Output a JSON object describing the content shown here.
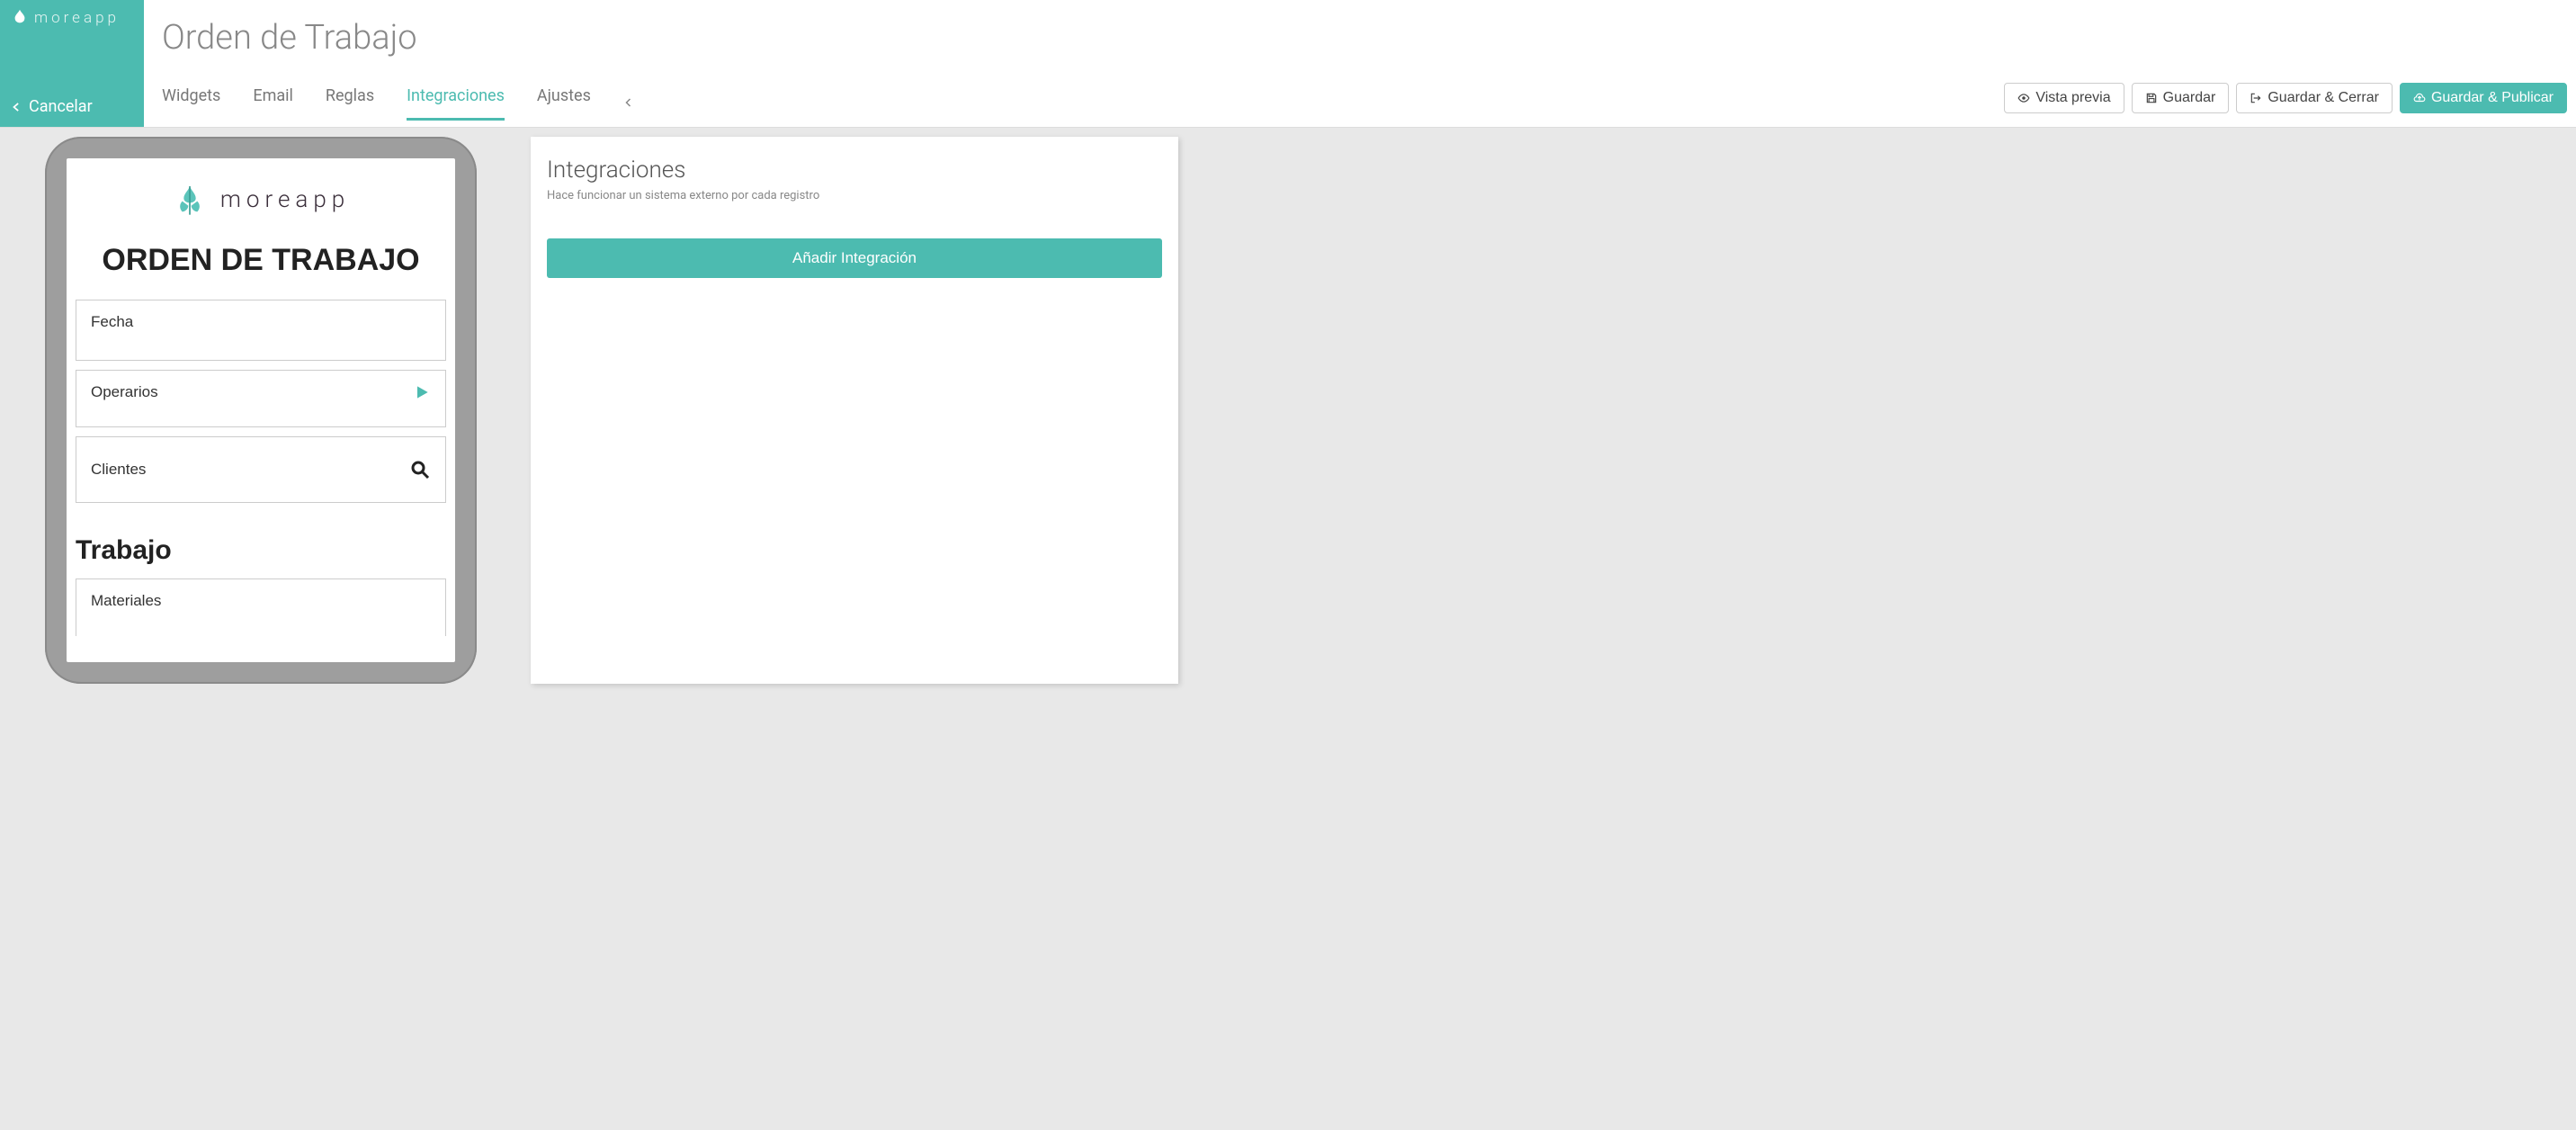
{
  "brand": {
    "name": "moreapp"
  },
  "cancel": {
    "label": "Cancelar"
  },
  "page": {
    "title": "Orden de Trabajo"
  },
  "tabs": {
    "widgets": "Widgets",
    "email": "Email",
    "rules": "Reglas",
    "integrations": "Integraciones",
    "settings": "Ajustes",
    "active": "integrations"
  },
  "actions": {
    "preview": "Vista previa",
    "save": "Guardar",
    "save_close": "Guardar & Cerrar",
    "save_publish": "Guardar & Publicar"
  },
  "preview": {
    "brand": "moreapp",
    "form_title": "ORDEN DE TRABAJO",
    "fields": {
      "date": "Fecha",
      "operators": "Operarios",
      "clients": "Clientes"
    },
    "section_work": "Trabajo",
    "materials": "Materiales"
  },
  "panel": {
    "title": "Integraciones",
    "subtitle": "Hace funcionar un sistema externo por cada registro",
    "add_button": "Añadir Integración"
  }
}
